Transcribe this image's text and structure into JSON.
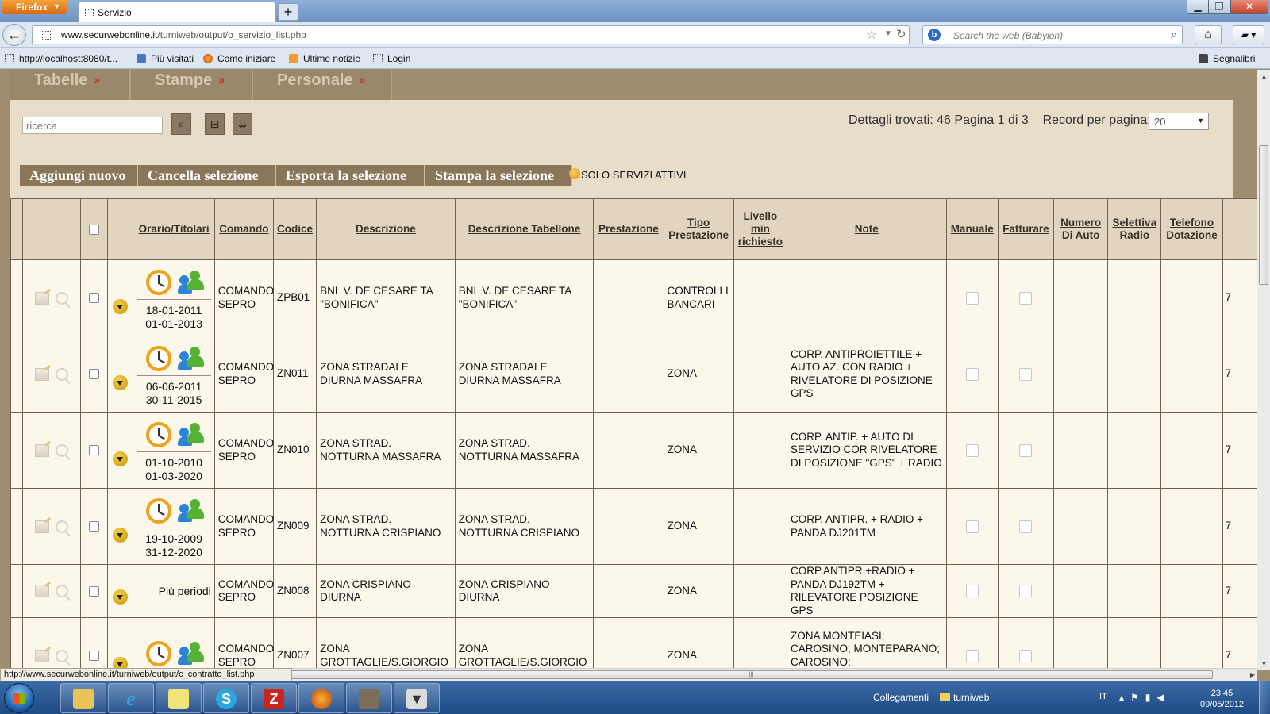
{
  "browser": {
    "app_button": "Firefox",
    "tab_title": "Servizio",
    "url_host": "www.securwebonline.it",
    "url_path": "/turniweb/output/o_servizio_list.php",
    "search_placeholder": "Search the web (Babylon)",
    "bookmarks": [
      {
        "label": "http://localhost:8080/t...",
        "icon": "page-icon"
      },
      {
        "label": "Più visitati",
        "icon": "most-visited-icon"
      },
      {
        "label": "Come iniziare",
        "icon": "firefox-icon"
      },
      {
        "label": "Ultime notizie",
        "icon": "rss-icon"
      },
      {
        "label": "Login",
        "icon": "page-icon"
      }
    ],
    "bookmarks_menu": "Segnalibri",
    "status_url": "http://www.securwebonline.it/turniweb/output/c_contratto_list.php"
  },
  "topnav": {
    "tabs": [
      {
        "label": "Tabelle",
        "marker": "»"
      },
      {
        "label": "Stampe",
        "marker": "»"
      },
      {
        "label": "Personale",
        "marker": "»"
      }
    ]
  },
  "search": {
    "placeholder": "ricerca",
    "found_text": "Dettagli trovati: 46  Pagina 1 di 3",
    "rpp_label": "Record per pagina:",
    "rpp_value": "20"
  },
  "actions": {
    "add": "Aggiungi nuovo",
    "delete": "Cancella selezione",
    "export": "Esporta la selezione",
    "print": "Stampa la selezione",
    "filter": "SOLO SERVIZI ATTIVI"
  },
  "table": {
    "columns": {
      "orario": "Orario/Titolari",
      "comando": "Comando",
      "codice": "Codice",
      "descrizione": "Descrizione",
      "descr_tabellone": "Descrizione Tabellone",
      "prestazione": "Prestazione",
      "tipo": "Tipo Prestazione",
      "livello": "Livello min richiesto",
      "note": "Note",
      "manuale": "Manuale",
      "fatturare": "Fatturare",
      "numero_auto": "Numero Di Auto",
      "selettiva": "Selettiva Radio",
      "telefono": "Telefono Dotazione"
    },
    "rows": [
      {
        "date_from": "18-01-2011",
        "date_to": "01-01-2013",
        "comando": "COMANDO SEPRO",
        "codice": "ZPB01",
        "descrizione": "BNL V. DE CESARE TA \"BONIFICA\"",
        "descr_tabellone": "BNL V. DE CESARE TA \"BONIFICA\"",
        "prestazione": "",
        "tipo": "CONTROLLI BANCARI",
        "livello": "",
        "note": "",
        "telefono": "7"
      },
      {
        "date_from": "06-06-2011",
        "date_to": "30-11-2015",
        "comando": "COMANDO SEPRO",
        "codice": "ZN011",
        "descrizione": "ZONA STRADALE DIURNA MASSAFRA",
        "descr_tabellone": "ZONA STRADALE DIURNA MASSAFRA",
        "prestazione": "",
        "tipo": "ZONA",
        "livello": "",
        "note": "CORP. ANTIPROIETTILE + AUTO AZ. CON RADIO + RIVELATORE DI POSIZIONE GPS",
        "telefono": "7"
      },
      {
        "date_from": "01-10-2010",
        "date_to": "01-03-2020",
        "comando": "COMANDO SEPRO",
        "codice": "ZN010",
        "descrizione": "ZONA STRAD. NOTTURNA MASSAFRA",
        "descr_tabellone": "ZONA STRAD. NOTTURNA MASSAFRA",
        "prestazione": "",
        "tipo": "ZONA",
        "livello": "",
        "note": "CORP. ANTIP. + AUTO DI SERVIZIO COR RIVELATORE DI POSIZIONE \"GPS\" + RADIO",
        "telefono": "7"
      },
      {
        "date_from": "19-10-2009",
        "date_to": "31-12-2020",
        "comando": "COMANDO SEPRO",
        "codice": "ZN009",
        "descrizione": "ZONA STRAD. NOTTURNA CRISPIANO",
        "descr_tabellone": "ZONA STRAD. NOTTURNA CRISPIANO",
        "prestazione": "",
        "tipo": "ZONA",
        "livello": "",
        "note": "CORP. ANTIPR. + RADIO + PANDA DJ201TM",
        "telefono": "7"
      },
      {
        "periods": "Più periodi",
        "comando": "COMANDO SEPRO",
        "codice": "ZN008",
        "descrizione": "ZONA CRISPIANO DIURNA",
        "descr_tabellone": "ZONA CRISPIANO DIURNA",
        "prestazione": "",
        "tipo": "ZONA",
        "livello": "",
        "note": "CORP.ANTIPR.+RADIO + PANDA DJ192TM + RILEVATORE POSIZIONE GPS",
        "telefono": "7"
      },
      {
        "date_from": "",
        "date_to": "",
        "comando": "COMANDO SEPRO",
        "codice": "ZN007",
        "descrizione": "ZONA GROTTAGLIE/S.GIORGIO",
        "descr_tabellone": "ZONA GROTTAGLIE/S.GIORGIO",
        "prestazione": "",
        "tipo": "ZONA",
        "livello": "",
        "note": "ZONA MONTEIASI; CAROSINO; MONTEPARANO; CAROSINO; ROCCAFORZATA; FAGGIANO;",
        "telefono": "7"
      }
    ]
  },
  "taskbar": {
    "links_label": "Collegamenti",
    "folder_label": "turniweb",
    "lang": "IT",
    "time": "23:45",
    "date": "09/05/2012"
  }
}
